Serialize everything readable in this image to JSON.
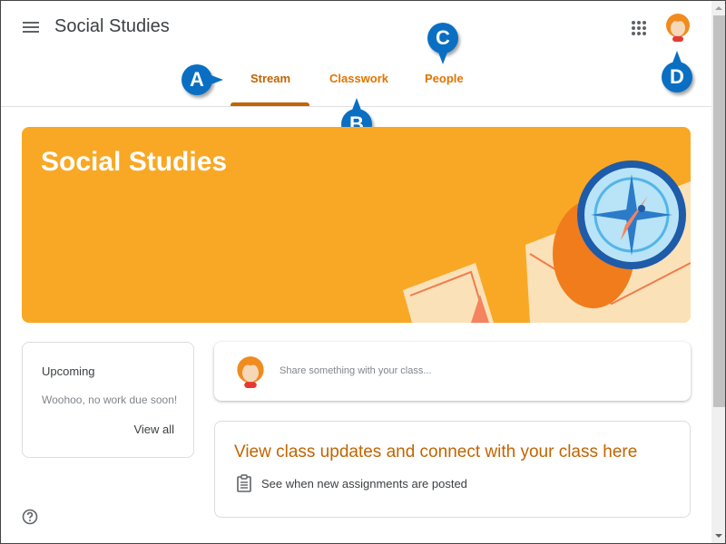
{
  "header": {
    "title": "Social Studies",
    "menu_icon": "hamburger-menu-icon",
    "apps_icon": "apps-grid-icon",
    "avatar_icon": "user-avatar"
  },
  "tabs": [
    {
      "label": "Stream",
      "active": true
    },
    {
      "label": "Classwork",
      "active": false
    },
    {
      "label": "People",
      "active": false
    }
  ],
  "callouts": {
    "a": "A",
    "b": "B",
    "c": "C",
    "d": "D"
  },
  "banner": {
    "title": "Social Studies",
    "color": "#f9a825"
  },
  "upcoming": {
    "title": "Upcoming",
    "empty_message": "Woohoo, no work due soon!",
    "view_all_label": "View all"
  },
  "share": {
    "placeholder": "Share something with your class..."
  },
  "updates": {
    "title": "View class updates and connect with your class here",
    "item": "See when new assignments are posted"
  },
  "colors": {
    "accent": "#c26401",
    "tab_text": "#e37400",
    "callout": "#0a6fc2"
  }
}
